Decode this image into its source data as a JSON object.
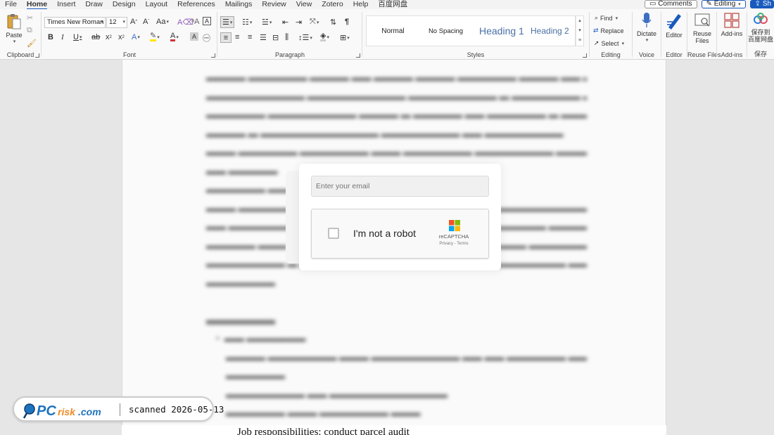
{
  "menubar": {
    "tabs": [
      {
        "label": "File",
        "active": false
      },
      {
        "label": "Home",
        "active": true
      },
      {
        "label": "Insert",
        "active": false
      },
      {
        "label": "Draw",
        "active": false
      },
      {
        "label": "Design",
        "active": false
      },
      {
        "label": "Layout",
        "active": false
      },
      {
        "label": "References",
        "active": false
      },
      {
        "label": "Mailings",
        "active": false
      },
      {
        "label": "Review",
        "active": false
      },
      {
        "label": "View",
        "active": false
      },
      {
        "label": "Zotero",
        "active": false
      },
      {
        "label": "Help",
        "active": false
      },
      {
        "label": "百度网盘",
        "active": false
      }
    ],
    "comments_label": "Comments",
    "editing_label": "Editing",
    "share_label": "Sh"
  },
  "ribbon": {
    "clipboard": {
      "paste_label": "Paste",
      "group_label": "Clipboard"
    },
    "font": {
      "font_name": "Times New Roman",
      "font_size": "12",
      "group_label": "Font"
    },
    "paragraph": {
      "group_label": "Paragraph"
    },
    "styles": {
      "items": [
        "Normal",
        "No Spacing",
        "Heading 1",
        "Heading 2"
      ],
      "group_label": "Styles"
    },
    "editing": {
      "find_label": "Find",
      "replace_label": "Replace",
      "select_label": "Select",
      "group_label": "Editing"
    },
    "voice": {
      "dictate_label": "Dictate",
      "group_label": "Voice"
    },
    "editor": {
      "editor_label": "Editor",
      "group_label": "Editor"
    },
    "reuse": {
      "button_label": "Reuse Files",
      "group_label": "Reuse Files"
    },
    "addins": {
      "button_label": "Add-ins",
      "group_label": "Add-ins"
    },
    "baidu": {
      "button_label_1": "保存到",
      "button_label_2": "百度网盘",
      "group_label": "保存"
    }
  },
  "document": {
    "bottom_text": "Job responsibilities: conduct parcel audit"
  },
  "modal": {
    "email_placeholder": "Enter your email",
    "captcha_label": "I'm not a robot",
    "captcha_brand": "reCAPTCHA",
    "captcha_links": "Privacy - Terms"
  },
  "watermark": {
    "logo_text": "PCrisk.com",
    "scan_text": "scanned 2026-05-13"
  },
  "colors": {
    "accent": "#185abd",
    "heading_style": "#4a6fa5",
    "watermark_blue": "#1e73be",
    "watermark_orange": "#f08a24"
  }
}
